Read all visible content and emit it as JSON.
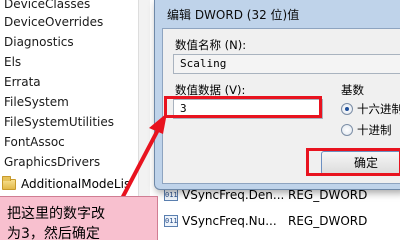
{
  "tree": {
    "items": [
      "DeviceClasses",
      "DeviceOverrides",
      "Diagnostics",
      "Els",
      "Errata",
      "FileSystem",
      "FileSystemUtilities",
      "FontAssoc",
      "GraphicsDrivers"
    ],
    "folder_item": "AdditionalModeLis"
  },
  "values_list": {
    "rows": [
      {
        "name": "VSyncFreq.Den...",
        "type": "REG_DWORD"
      },
      {
        "name": "VSyncFreq.Nu...",
        "type": "REG_DWORD"
      }
    ],
    "icon_text": "011"
  },
  "dialog": {
    "title": "编辑 DWORD (32 位)值",
    "name_label": "数值名称 (N):",
    "name_value": "Scaling",
    "data_label": "数值数据 (V):",
    "data_value": "3",
    "base_label": "基数",
    "radio_hex": "十六进制",
    "radio_dec": "十进制",
    "hex_checked": true,
    "ok_label": "确定"
  },
  "annotation": {
    "callout_line1": "把这里的数字改",
    "callout_line2": "为3，然后确定",
    "color": "#e8131f"
  }
}
